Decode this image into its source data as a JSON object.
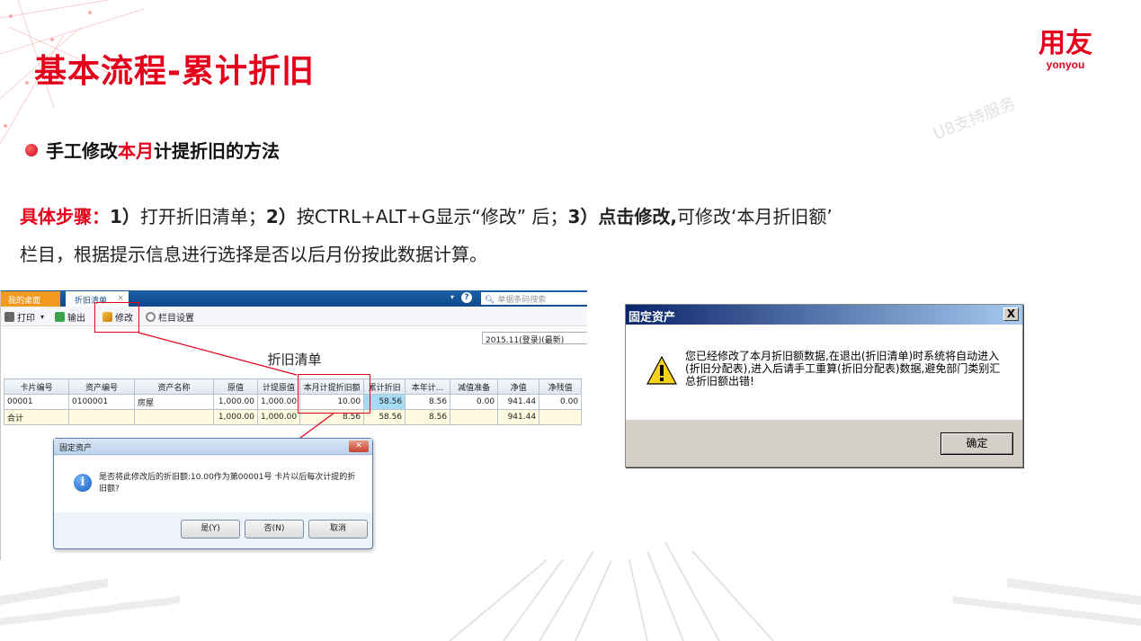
{
  "slide": {
    "title": "基本流程-累计折旧",
    "logo_main": "用友",
    "logo_sub": "yonyou",
    "watermark": "U8支持服务",
    "bullet_part1": "手工修改",
    "bullet_highlight": "本月",
    "bullet_part2": "计提折旧的方法",
    "steps_label": "具体步骤：",
    "step1_num": "1）",
    "step1_text": "打开折旧清单；",
    "step2_num": "2）",
    "step2_text": "按CTRL+ALT+G显示“修改” 后；",
    "step3_label": "3）点击修改,",
    "step3_text": "可修改‘本月折旧额’",
    "steps_line2": "栏目，根据提示信息进行选择是否以后月份按此数据计算。",
    "accent_color": "#e4001b"
  },
  "u8": {
    "tab_desk": "我的桌面",
    "tab_list": "折旧清单",
    "tab_close": "×",
    "search_placeholder": "单据条码搜索",
    "toolbar": {
      "print": "打印",
      "export": "输出",
      "modify": "修改",
      "column_settings": "栏目设置"
    },
    "period": "2015.11(登录)(最新)",
    "heading": "折旧清单",
    "columns": [
      "卡片编号",
      "资产编号",
      "资产名称",
      "原值",
      "计提原值",
      "本月计提折旧额",
      "累计折旧",
      "本年计...",
      "减值准备",
      "净值",
      "净残值"
    ],
    "rows": [
      [
        "00001",
        "0100001",
        "房屋",
        "1,000.00",
        "1,000.00",
        "10.00",
        "58.56",
        "8.56",
        "0.00",
        "941.44",
        "0.00"
      ],
      [
        "合计",
        "",
        "",
        "1,000.00",
        "1,000.00",
        "8.56",
        "58.56",
        "8.56",
        "",
        "941.44",
        ""
      ]
    ]
  },
  "dialog_small": {
    "title": "固定资产",
    "message": "是否将此修改后的折旧额:10.00作为第00001号 卡片以后每次计提的折旧额?",
    "btn_yes": "是(Y)",
    "btn_no": "否(N)",
    "btn_cancel": "取消"
  },
  "dialog_classic": {
    "title": "固定资产",
    "close": "X",
    "message": "您已经修改了本月折旧额数据,在退出(折旧清单)时系统将自动进入(折旧分配表),进入后请手工重算(折旧分配表)数据,避免部门类别汇总折旧额出错!",
    "ok": "确定"
  }
}
